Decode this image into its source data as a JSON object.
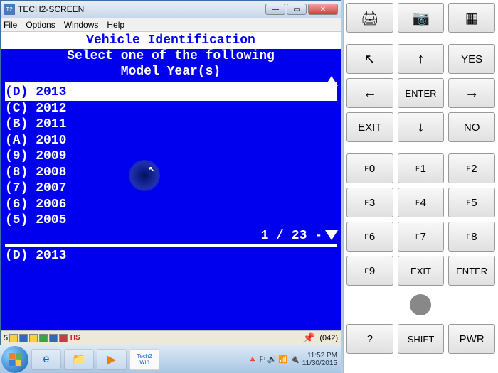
{
  "window": {
    "title": "TECH2-SCREEN",
    "menus": [
      "File",
      "Options",
      "Windows",
      "Help"
    ],
    "win_btn": {
      "min": "—",
      "max": "▭",
      "close": "✕"
    }
  },
  "screen": {
    "header": "Vehicle Identification",
    "sub1": "Select one of the following",
    "sub2": "Model Year(s)",
    "items": [
      {
        "code": "(D)",
        "year": "2013",
        "selected": true
      },
      {
        "code": "(C)",
        "year": "2012"
      },
      {
        "code": "(B)",
        "year": "2011"
      },
      {
        "code": "(A)",
        "year": "2010"
      },
      {
        "code": "(9)",
        "year": "2009"
      },
      {
        "code": "(8)",
        "year": "2008"
      },
      {
        "code": "(7)",
        "year": "2007"
      },
      {
        "code": "(6)",
        "year": "2006"
      },
      {
        "code": "(5)",
        "year": "2005"
      }
    ],
    "pager": "1 / 23 -",
    "echo_code": "(D)",
    "echo_year": "2013"
  },
  "status": {
    "num": "5",
    "tis": "TIS",
    "counter": "(042)"
  },
  "keypad": {
    "top": {
      "a": "🖨",
      "b": "📷",
      "c": "▦"
    },
    "nav": {
      "nw": "↖",
      "up": "↑",
      "yes": "YES",
      "left": "←",
      "enter": "ENTER",
      "right": "→",
      "exit": "EXIT",
      "down": "↓",
      "no": "NO"
    },
    "f": {
      "0": "0",
      "1": "1",
      "2": "2",
      "3": "3",
      "4": "4",
      "5": "5",
      "6": "6",
      "7": "7",
      "8": "8",
      "9": "9",
      "exit": "EXIT",
      "enter": "ENTER"
    },
    "bottom": {
      "q": "?",
      "shift": "SHIFT",
      "pwr": "PWR"
    }
  },
  "taskbar": {
    "tech2_a": "Tech2",
    "tech2_b": "Win",
    "time": "11:52 PM",
    "date": "11/30/2015"
  }
}
